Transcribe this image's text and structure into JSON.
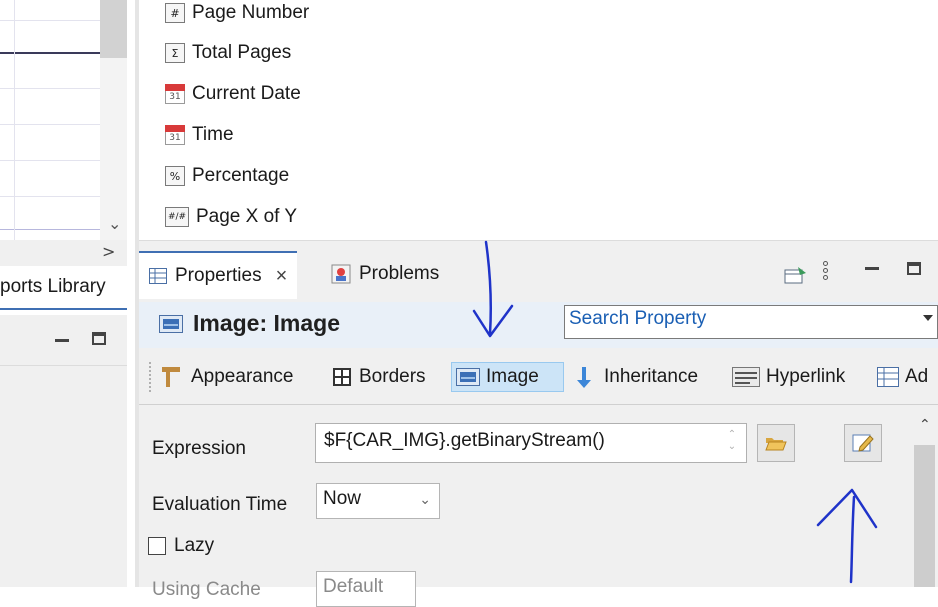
{
  "left": {
    "tab_label": "ports Library",
    "scroll_right_glyph": ">",
    "scroll_down_glyph": "⌄"
  },
  "palette": {
    "items": [
      {
        "icon": "#",
        "label": "Page Number"
      },
      {
        "icon": "Σ",
        "label": "Total Pages"
      },
      {
        "icon": "31",
        "label": "Current Date"
      },
      {
        "icon": "31",
        "label": "Time"
      },
      {
        "icon": "%",
        "label": "Percentage"
      },
      {
        "icon": "#/#",
        "label": "Page X of Y"
      }
    ]
  },
  "properties": {
    "tab_properties": "Properties",
    "tab_close": "×",
    "tab_problems": "Problems",
    "title": "Image: Image",
    "search_placeholder": "Search Property",
    "sections": [
      "Appearance",
      "Borders",
      "Image",
      "Inheritance",
      "Hyperlink",
      "Ad"
    ],
    "expression_label": "Expression",
    "expression_value": "$F{CAR_IMG}.getBinaryStream()",
    "evaluation_time_label": "Evaluation Time",
    "evaluation_time_value": "Now",
    "lazy_label": "Lazy",
    "using_cache_label": "Using Cache",
    "using_cache_value": "Default"
  },
  "colors": {
    "accent": "#3f6fb3",
    "annotation_ink": "#1f33c9",
    "selected_tab": "#cce4f7"
  }
}
